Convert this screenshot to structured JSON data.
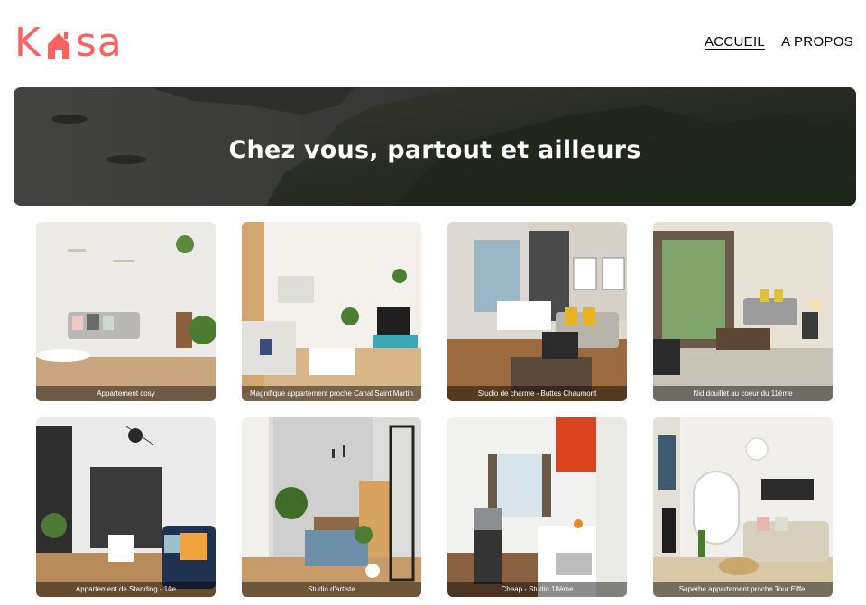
{
  "header": {
    "logo_text": "Kasa",
    "nav": [
      {
        "label": "ACCUEIL",
        "active": true
      },
      {
        "label": "A PROPOS",
        "active": false
      }
    ]
  },
  "banner": {
    "title": "Chez vous, partout et ailleurs"
  },
  "listings": [
    {
      "title": "Appartement cosy"
    },
    {
      "title": "Magnifique appartement proche Canal Saint Martin"
    },
    {
      "title": "Studio de charme - Buttes Chaumont"
    },
    {
      "title": "Nid douillet au coeur du 11ème"
    },
    {
      "title": "Appartement de Standing - 10e"
    },
    {
      "title": "Studio d'artiste"
    },
    {
      "title": "Cheap - Studio 18ème"
    },
    {
      "title": "Superbe appartement proche Tour Eiffel"
    }
  ],
  "colors": {
    "brand": "#FF6060",
    "caption_bg": "rgba(0,0,0,0.45)"
  }
}
